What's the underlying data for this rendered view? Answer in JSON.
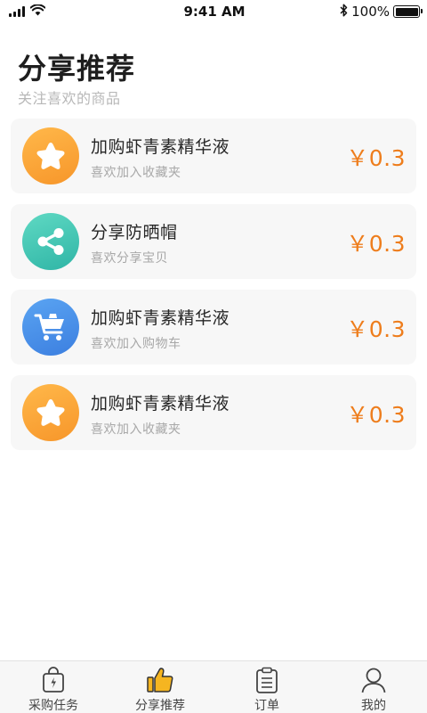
{
  "status_bar": {
    "time": "9:41 AM",
    "battery_text": "100%",
    "icons": [
      "signal-icon",
      "wifi-icon",
      "bluetooth-icon",
      "battery-icon"
    ]
  },
  "header": {
    "title": "分享推荐",
    "subtitle": "关注喜欢的商品"
  },
  "cards": [
    {
      "title": "加购虾青素精华液",
      "desc": "喜欢加入收藏夹",
      "price": "￥0.3",
      "icon": "star-icon",
      "color": "#f9a13a"
    },
    {
      "title": "分享防晒帽",
      "desc": "喜欢分享宝贝",
      "price": "￥0.3",
      "icon": "share-icon",
      "color": "#3dc4b1"
    },
    {
      "title": "加购虾青素精华液",
      "desc": "喜欢加入购物车",
      "price": "￥0.3",
      "icon": "cart-icon",
      "color": "#4a8fe8"
    },
    {
      "title": "加购虾青素精华液",
      "desc": "喜欢加入收藏夹",
      "price": "￥0.3",
      "icon": "star-icon",
      "color": "#f9a13a"
    }
  ],
  "tabs": [
    {
      "label": "采购任务",
      "icon": "shopping-bag-icon",
      "active": false
    },
    {
      "label": "分享推荐",
      "icon": "thumbs-up-icon",
      "active": true
    },
    {
      "label": "订单",
      "icon": "clipboard-icon",
      "active": false
    },
    {
      "label": "我的",
      "icon": "user-icon",
      "active": false
    }
  ],
  "colors": {
    "accent": "#ee7d1c",
    "active_tab_icon": "#f5b521"
  }
}
